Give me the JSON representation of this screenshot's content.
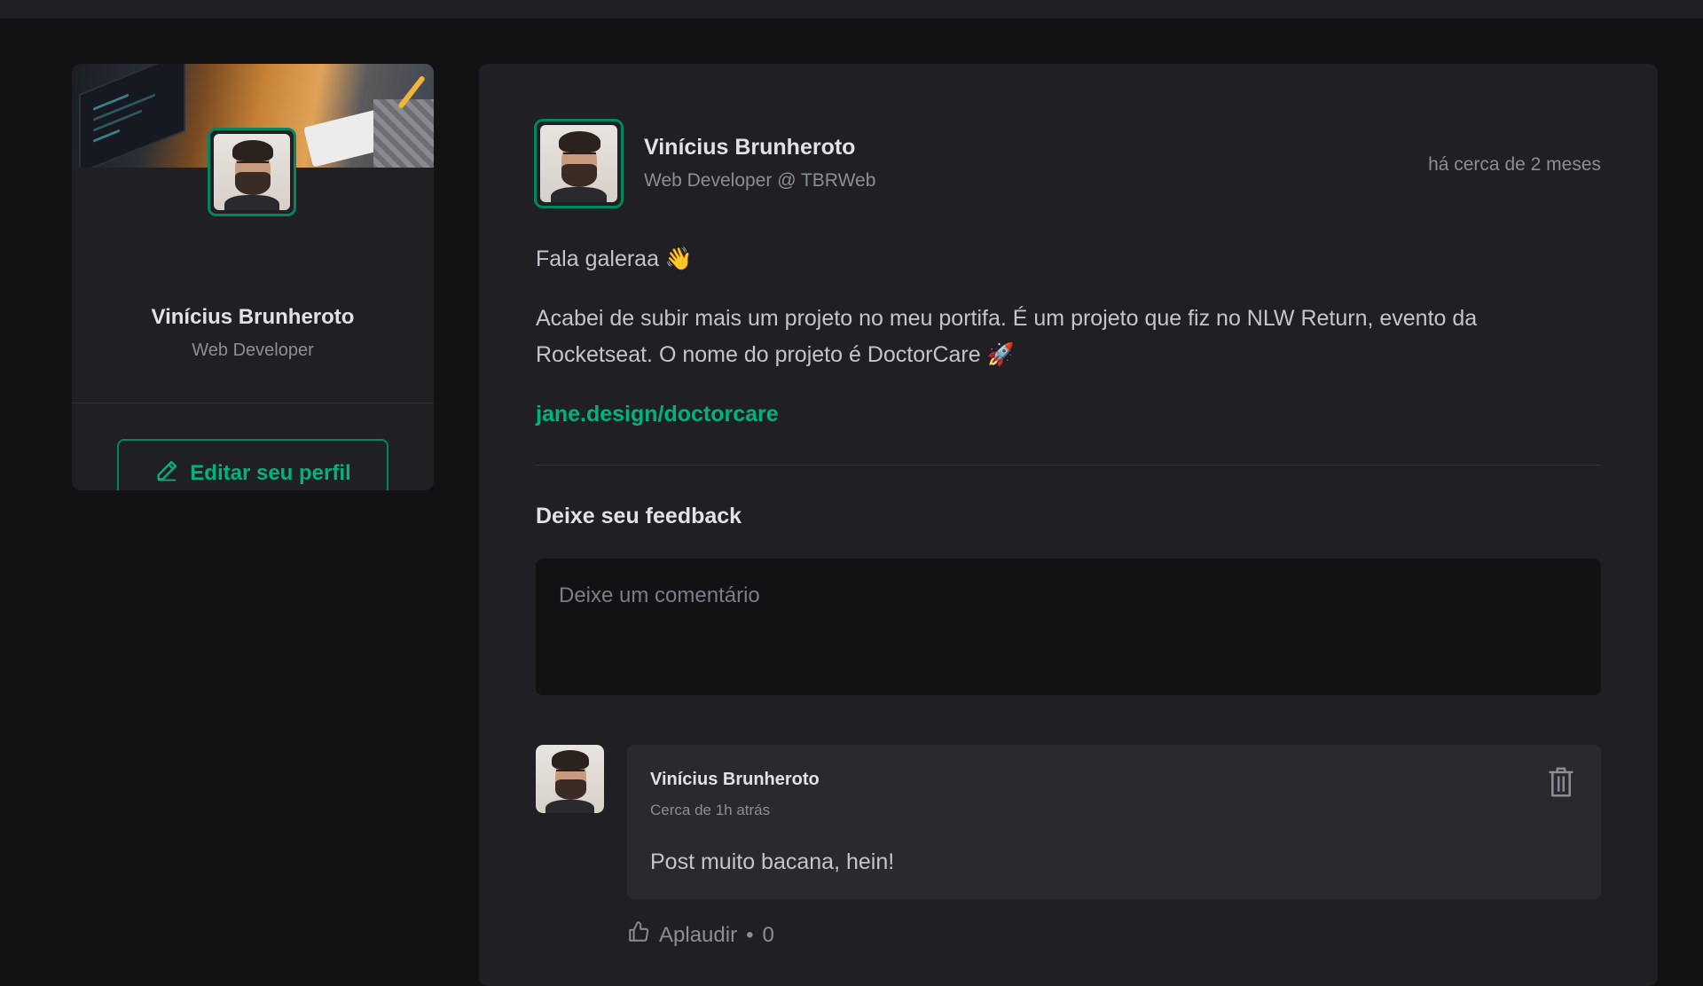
{
  "theme": {
    "background": "#121214",
    "card": "#202024",
    "accent": "#00875f",
    "accent_light": "#00b37e"
  },
  "sidebar": {
    "name": "Vinícius Brunheroto",
    "role": "Web Developer",
    "edit_button_label": "Editar seu perfil",
    "edit_icon": "pencil-icon"
  },
  "post": {
    "author": {
      "name": "Vinícius Brunheroto",
      "role": "Web Developer @ TBRWeb"
    },
    "published": "há cerca de 2 meses",
    "content": {
      "greeting": "Fala galeraa 👋",
      "paragraph": "Acabei de subir mais um projeto no meu portifa. É um projeto que fiz no NLW Return, evento da Rocketseat. O nome do projeto é DoctorCare 🚀",
      "link": "jane.design/doctorcare"
    },
    "feedback": {
      "title": "Deixe seu feedback",
      "placeholder": "Deixe um comentário",
      "value": ""
    },
    "comments": [
      {
        "author": "Vinícius Brunheroto",
        "time": "Cerca de 1h atrás",
        "text": "Post muito bacana, hein!",
        "delete_icon": "trash-icon",
        "applaud_label": "Aplaudir",
        "separator": "•",
        "applaud_count": "0",
        "applaud_icon": "thumbs-up-icon"
      }
    ]
  }
}
